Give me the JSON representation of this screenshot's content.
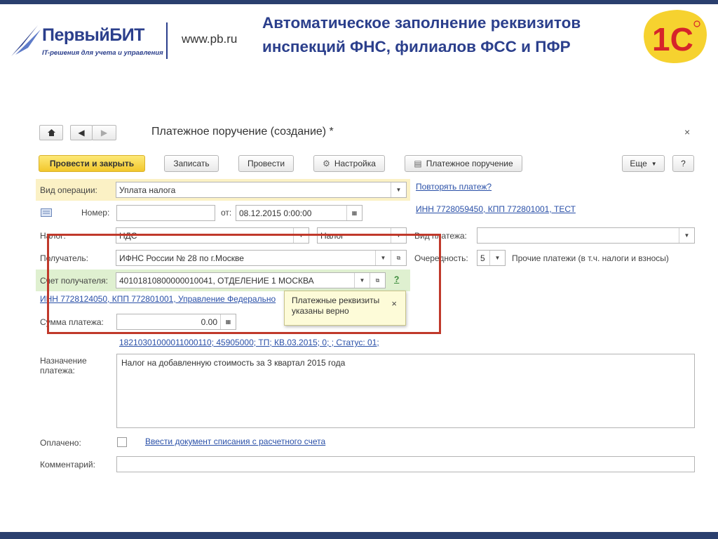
{
  "header": {
    "logo_name": "ПервыйБИТ",
    "logo_tagline": "IT-решения для учета и управления",
    "url": "www.pb.ru",
    "title": "Автоматическое заполнение реквизитов инспекций ФНС, филиалов ФСС и ПФР",
    "onec_logo_text": "1С"
  },
  "form": {
    "title": "Платежное поручение (создание) *",
    "close": "×",
    "toolbar": {
      "post_close": "Провести и закрыть",
      "save": "Записать",
      "post": "Провести",
      "settings": "Настройка",
      "print": "Платежное поручение",
      "more": "Еще",
      "help": "?"
    },
    "operation_type": {
      "label": "Вид операции:",
      "value": "Уплата налога"
    },
    "repeat_payment_link": "Повторять платеж?",
    "number": {
      "label": "Номер:",
      "value": ""
    },
    "date": {
      "label": "от:",
      "value": "08.12.2015  0:00:00"
    },
    "org_link": "ИНН 7728059450, КПП 772801001, ТЕСТ",
    "tax": {
      "label": "Налог:",
      "value": "НДС",
      "kind_value": "Налог"
    },
    "payment_kind": {
      "label": "Вид платежа:",
      "value": ""
    },
    "recipient": {
      "label": "Получатель:",
      "value": "ИФНС России № 28 по г.Москве"
    },
    "priority": {
      "label": "Очередность:",
      "value": "5",
      "description": "Прочие платежи (в т.ч. налоги и взносы)"
    },
    "recipient_account": {
      "label": "Счет получателя:",
      "value": "40101810800000010041, ОТДЕЛЕНИЕ 1 МОСКВА",
      "help": "?"
    },
    "recipient_link": "ИНН 7728124050, КПП 772801001, Управление Федерально",
    "tooltip": {
      "text": "Платежные реквизиты указаны верно",
      "close": "×"
    },
    "amount": {
      "label": "Сумма платежа:",
      "value": "0.00"
    },
    "kbk_link": "18210301000011000110; 45905000; ТП; КВ.03.2015; 0; ; Статус: 01;",
    "purpose": {
      "label": "Назначение платежа:",
      "value": "Налог на добавленную стоимость за 3 квартал 2015 года"
    },
    "paid": {
      "label": "Оплачено:",
      "link": "Ввести документ списания с расчетного счета"
    },
    "comment": {
      "label": "Комментарий:",
      "value": ""
    }
  }
}
